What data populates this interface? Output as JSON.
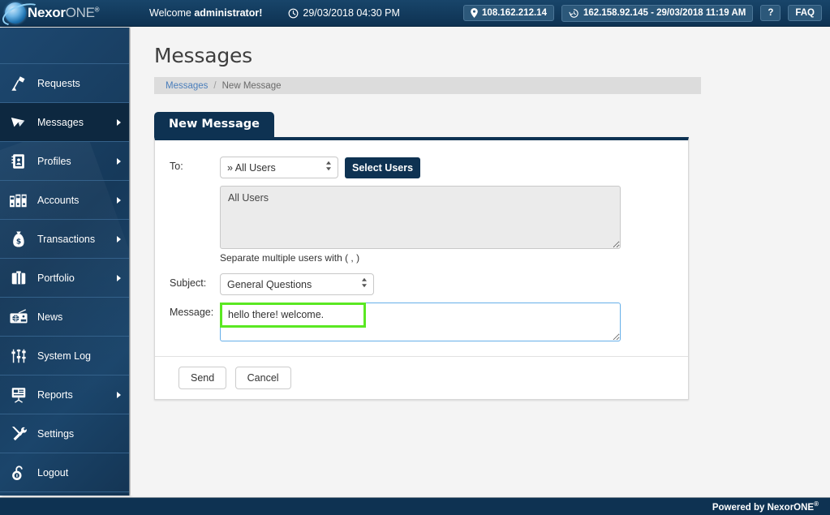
{
  "header": {
    "logo": {
      "nexor": "Nexor",
      "one": "ONE",
      "registered": "®",
      "icon": "globe-orb-logo-icon"
    },
    "welcome_prefix": "Welcome ",
    "welcome_user": "administrator!",
    "datetime": "29/03/2018 04:30 PM",
    "datetime_icon": "clock-icon",
    "current_ip": "108.162.212.14",
    "current_ip_icon": "location-pin-icon",
    "last_login": "162.158.92.145 - 29/03/2018 11:19 AM",
    "last_login_icon": "history-clock-icon",
    "help_label": "?",
    "faq_label": "FAQ"
  },
  "sidebar": {
    "items": [
      {
        "label": "Requests",
        "icon": "desk-lamp-icon",
        "has_submenu": false,
        "active": false
      },
      {
        "label": "Messages",
        "icon": "paper-plane-icon",
        "has_submenu": true,
        "active": true
      },
      {
        "label": "Profiles",
        "icon": "address-book-icon",
        "has_submenu": true,
        "active": false
      },
      {
        "label": "Accounts",
        "icon": "binders-icon",
        "has_submenu": true,
        "active": false
      },
      {
        "label": "Transactions",
        "icon": "money-bag-icon",
        "has_submenu": true,
        "active": false
      },
      {
        "label": "Portfolio",
        "icon": "briefcase-icon",
        "has_submenu": true,
        "active": false
      },
      {
        "label": "News",
        "icon": "radio-icon",
        "has_submenu": false,
        "active": false
      },
      {
        "label": "System Log",
        "icon": "sliders-icon",
        "has_submenu": false,
        "active": false
      },
      {
        "label": "Reports",
        "icon": "presentation-icon",
        "has_submenu": true,
        "active": false
      },
      {
        "label": "Settings",
        "icon": "wrench-screwdriver-icon",
        "has_submenu": false,
        "active": false
      },
      {
        "label": "Logout",
        "icon": "unlocked-padlock-icon",
        "has_submenu": false,
        "active": false
      }
    ]
  },
  "main": {
    "page_title": "Messages",
    "breadcrumb": {
      "parent": "Messages",
      "separator": "/",
      "current": "New Message"
    },
    "tab_label": "New Message",
    "form": {
      "to_label": "To:",
      "to_select_value": "» All Users",
      "select_users_button": "Select Users",
      "to_textarea_value": "All Users",
      "to_hint": "Separate multiple users with ( , )",
      "subject_label": "Subject:",
      "subject_select_value": "General Questions",
      "message_label": "Message:",
      "message_value": "hello there! welcome.",
      "send_button": "Send",
      "cancel_button": "Cancel"
    }
  },
  "footer": {
    "text": "Powered by NexorONE",
    "registered": "®"
  },
  "colors": {
    "brand_dark": "#0e3252",
    "sidebar": "#1a4165",
    "accent_link": "#4a7ebb",
    "highlight_green": "#5ae822",
    "focus_blue": "#66afe9",
    "pill_bg": "#2c587a",
    "breadcrumb_bg": "#dcdcdc"
  }
}
